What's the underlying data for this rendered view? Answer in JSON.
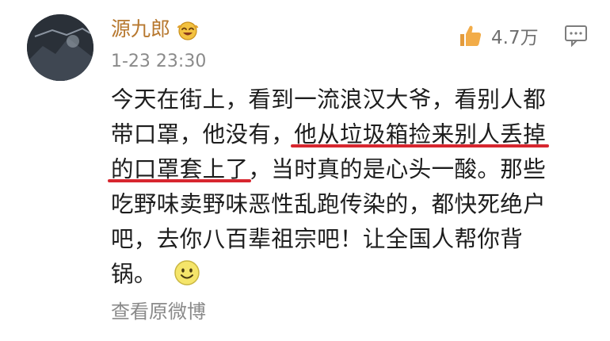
{
  "post": {
    "username": "源九郎",
    "timestamp": "1-23 23:30",
    "likes": "4.7万",
    "view_original": "查看原微博"
  },
  "content": {
    "line1": "今天在街上，看到一流浪汉大爷，看别人都",
    "line2_a": "带口罩，他没有，",
    "line2_b": "他从垃圾箱捡来别人丢掉",
    "line3_a": "的口罩套上了",
    "line3_b": "，当时真的是心头一酸。那些",
    "line4": "吃野味卖野味恶性乱跑传染的，都快死绝户",
    "line5": "吧，去你八百辈祖宗吧！让全国人帮你背",
    "line6": "锅。"
  },
  "icons": {
    "avatar": "avatar-image",
    "badge": "laughing-emoji-icon",
    "like": "thumbs-up-icon",
    "comment": "comment-icon",
    "smile": "smile-emoji-icon"
  },
  "colors": {
    "username": "#b7782f",
    "highlight_underline": "#d7262f",
    "secondary_text": "#8a8a8a",
    "body_text": "#1d1d1d"
  }
}
